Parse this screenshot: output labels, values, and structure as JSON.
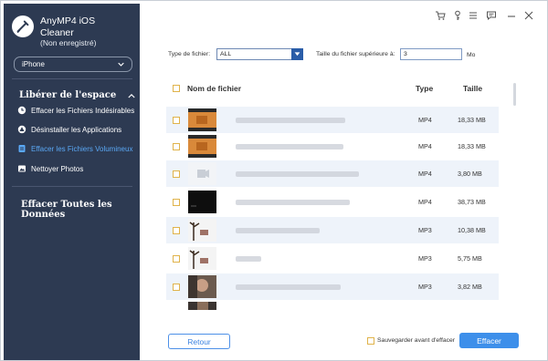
{
  "app": {
    "title_line1": "AnyMP4 iOS",
    "title_line2": "Cleaner",
    "subtitle": "(Non enregistré)"
  },
  "device": {
    "selected": "iPhone"
  },
  "sidebar": {
    "section1_title": "Libérer de l'espace",
    "items": [
      {
        "label": "Effacer les Fichiers Indésirables",
        "icon": "clock-icon",
        "active": false
      },
      {
        "label": "Désinstaller les Applications",
        "icon": "apps-icon",
        "active": false
      },
      {
        "label": "Effacer les Fichiers Volumineux",
        "icon": "file-icon",
        "active": true
      },
      {
        "label": "Nettoyer Photos",
        "icon": "photo-icon",
        "active": false
      }
    ],
    "section2_title": "Effacer Toutes les Données"
  },
  "titlebar_icons": [
    "cart-icon",
    "key-icon",
    "menu-icon",
    "feedback-icon",
    "minimize-icon",
    "close-icon"
  ],
  "filter": {
    "type_label": "Type de fichier:",
    "type_value": "ALL",
    "size_label": "Taille du fichier supérieure à:",
    "size_value": "3",
    "size_unit": "Mo"
  },
  "table": {
    "headers": {
      "name": "Nom de fichier",
      "type": "Type",
      "size": "Taille"
    },
    "rows": [
      {
        "type": "MP4",
        "size": "18,33 MB",
        "thumb": "orange-video"
      },
      {
        "type": "MP4",
        "size": "18,33 MB",
        "thumb": "orange-video"
      },
      {
        "type": "MP4",
        "size": "3,80 MB",
        "thumb": "blank-video"
      },
      {
        "type": "MP4",
        "size": "38,73 MB",
        "thumb": "dark-video"
      },
      {
        "type": "MP3",
        "size": "10,38 MB",
        "thumb": "audio-tree"
      },
      {
        "type": "MP3",
        "size": "5,75 MB",
        "thumb": "audio-tree"
      },
      {
        "type": "MP3",
        "size": "3,82 MB",
        "thumb": "portrait"
      }
    ]
  },
  "footer": {
    "back_label": "Retour",
    "save_label": "Sauvegarder avant d'effacer",
    "erase_label": "Effacer"
  },
  "colors": {
    "sidebar_bg": "#2d3a52",
    "accent": "#3d8fea",
    "active_item": "#5aa8f5",
    "checkbox_border": "#e0b34a",
    "row_shade": "#eef3fa"
  }
}
